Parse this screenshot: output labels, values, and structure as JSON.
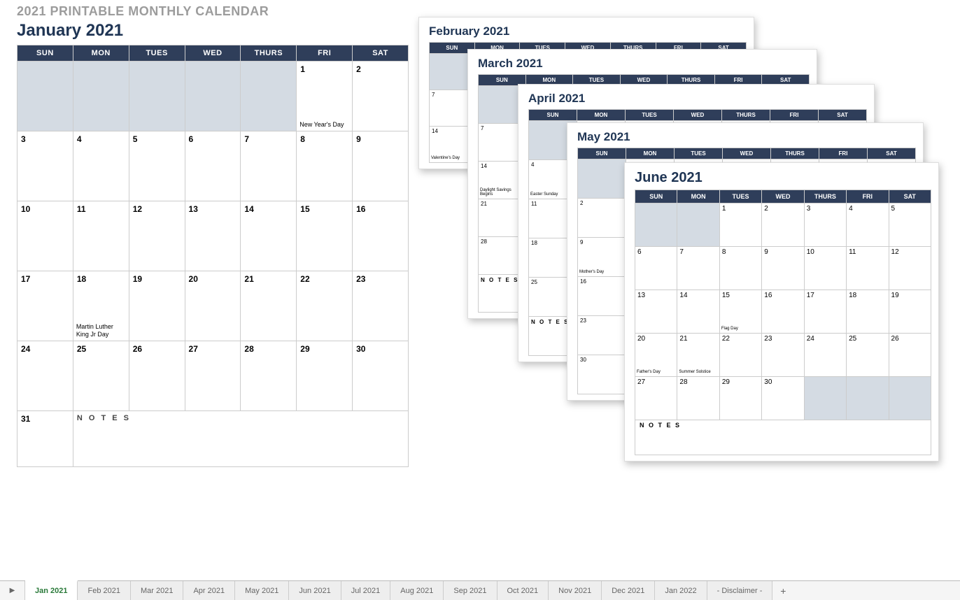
{
  "page_title": "2021 PRINTABLE MONTHLY CALENDAR",
  "days": [
    "SUN",
    "MON",
    "TUES",
    "WED",
    "THURS",
    "FRI",
    "SAT"
  ],
  "notes_label": "N O T E S",
  "jan": {
    "title": "January 2021",
    "weeks": [
      [
        {
          "grey": true
        },
        {
          "grey": true
        },
        {
          "grey": true
        },
        {
          "grey": true
        },
        {
          "grey": true
        },
        {
          "n": "1",
          "ev": "New Year's Day"
        },
        {
          "n": "2"
        }
      ],
      [
        {
          "n": "3"
        },
        {
          "n": "4"
        },
        {
          "n": "5"
        },
        {
          "n": "6"
        },
        {
          "n": "7"
        },
        {
          "n": "8"
        },
        {
          "n": "9"
        }
      ],
      [
        {
          "n": "10"
        },
        {
          "n": "11"
        },
        {
          "n": "12"
        },
        {
          "n": "13"
        },
        {
          "n": "14"
        },
        {
          "n": "15"
        },
        {
          "n": "16"
        }
      ],
      [
        {
          "n": "17"
        },
        {
          "n": "18",
          "ev": "Martin Luther King Jr Day"
        },
        {
          "n": "19"
        },
        {
          "n": "20"
        },
        {
          "n": "21"
        },
        {
          "n": "22"
        },
        {
          "n": "23"
        }
      ],
      [
        {
          "n": "24"
        },
        {
          "n": "25"
        },
        {
          "n": "26"
        },
        {
          "n": "27"
        },
        {
          "n": "28"
        },
        {
          "n": "29"
        },
        {
          "n": "30"
        }
      ]
    ],
    "last": "31"
  },
  "feb": {
    "title": "February 2021",
    "rows": [
      [
        "7"
      ],
      [
        "14",
        "Valentine's Day"
      ]
    ]
  },
  "mar": {
    "title": "March 2021",
    "rows": [
      [
        "7"
      ],
      [
        "14",
        "Daylight Savings Begins"
      ],
      [
        "21"
      ],
      [
        "28"
      ]
    ]
  },
  "apr": {
    "title": "April 2021",
    "rows": [
      [
        "4",
        "Easter Sunday"
      ],
      [
        "11"
      ],
      [
        "18"
      ],
      [
        "25"
      ]
    ]
  },
  "may": {
    "title": "May 2021",
    "rows": [
      [
        "2"
      ],
      [
        "9",
        "Mother's Day"
      ],
      [
        "16"
      ],
      [
        "23"
      ],
      [
        "30"
      ]
    ]
  },
  "jun": {
    "title": "June 2021",
    "weeks": [
      [
        {
          "grey": true
        },
        {
          "grey": true
        },
        {
          "n": "1"
        },
        {
          "n": "2"
        },
        {
          "n": "3"
        },
        {
          "n": "4"
        },
        {
          "n": "5"
        }
      ],
      [
        {
          "n": "6"
        },
        {
          "n": "7"
        },
        {
          "n": "8"
        },
        {
          "n": "9"
        },
        {
          "n": "10"
        },
        {
          "n": "11"
        },
        {
          "n": "12"
        }
      ],
      [
        {
          "n": "13"
        },
        {
          "n": "14"
        },
        {
          "n": "15",
          "ev": "Flag Day"
        },
        {
          "n": "16"
        },
        {
          "n": "17"
        },
        {
          "n": "18"
        },
        {
          "n": "19"
        }
      ],
      [
        {
          "n": "20",
          "ev": "Father's Day"
        },
        {
          "n": "21",
          "ev": "Summer Solstice"
        },
        {
          "n": "22"
        },
        {
          "n": "23"
        },
        {
          "n": "24"
        },
        {
          "n": "25"
        },
        {
          "n": "26"
        }
      ],
      [
        {
          "n": "27"
        },
        {
          "n": "28"
        },
        {
          "n": "29"
        },
        {
          "n": "30"
        },
        {
          "grey": true
        },
        {
          "grey": true
        },
        {
          "grey": true
        }
      ]
    ]
  },
  "tabs": [
    "Jan 2021",
    "Feb 2021",
    "Mar 2021",
    "Apr 2021",
    "May 2021",
    "Jun 2021",
    "Jul 2021",
    "Aug 2021",
    "Sep 2021",
    "Oct 2021",
    "Nov 2021",
    "Dec 2021",
    "Jan 2022",
    "- Disclaimer -"
  ],
  "active_tab": 0
}
